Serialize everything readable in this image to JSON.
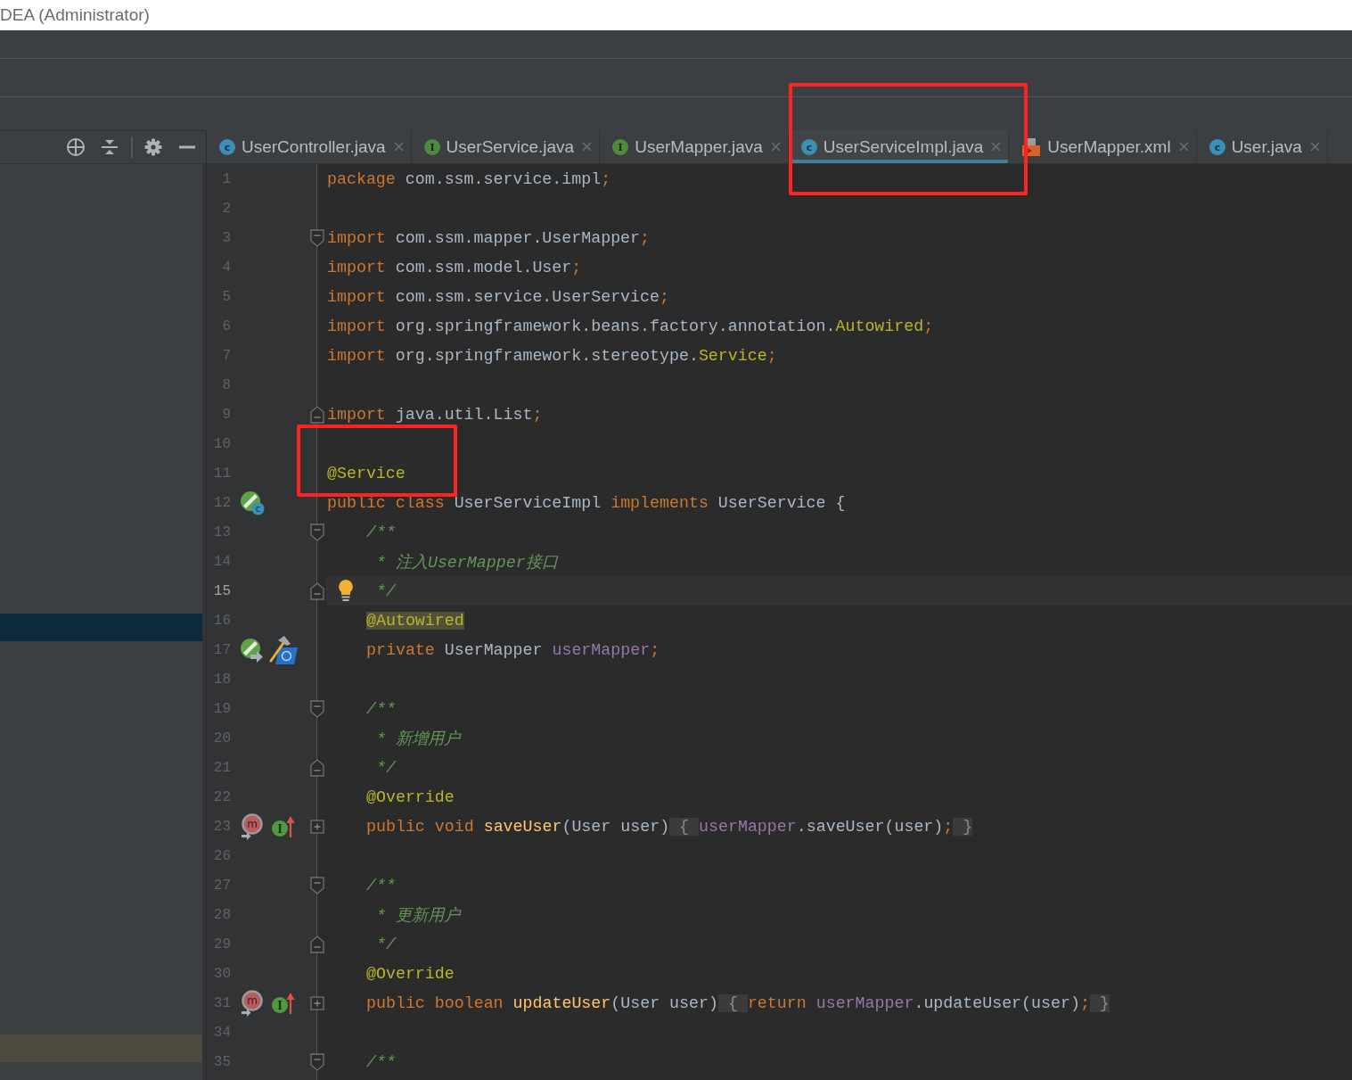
{
  "window": {
    "title": "DEA (Administrator)"
  },
  "project_panel": {
    "rows": [
      {
        "selected": true,
        "highlighted": false
      },
      {
        "selected": false,
        "highlighted": true
      }
    ]
  },
  "tabs": [
    {
      "label": "UserController.java",
      "kind": "class",
      "icon_letter": "c",
      "selected": false,
      "annotated": false
    },
    {
      "label": "UserService.java",
      "kind": "interface",
      "icon_letter": "I",
      "selected": false,
      "annotated": false
    },
    {
      "label": "UserMapper.java",
      "kind": "interface",
      "icon_letter": "I",
      "selected": false,
      "annotated": false
    },
    {
      "label": "UserServiceImpl.java",
      "kind": "class",
      "icon_letter": "c",
      "selected": true,
      "annotated": true
    },
    {
      "label": "UserMapper.xml",
      "kind": "xml",
      "selected": false,
      "annotated": false
    },
    {
      "label": "User.java",
      "kind": "class",
      "icon_letter": "c",
      "selected": false,
      "annotated": false
    }
  ],
  "editor": {
    "lines": [
      {
        "number": "1",
        "kind": "text",
        "tokens": [
          {
            "kind": "keyword",
            "text": "package"
          },
          {
            "kind": "plain",
            "text": " com.ssm.service.impl"
          },
          {
            "kind": "punct",
            "text": ";"
          }
        ],
        "current": false,
        "annotated": false
      },
      {
        "number": "2",
        "kind": "text",
        "current": false,
        "annotated": false
      },
      {
        "number": "3",
        "kind": "fold-start",
        "tokens": [
          {
            "kind": "keyword",
            "text": "import"
          },
          {
            "kind": "plain",
            "text": " com.ssm.mapper.UserMapper"
          },
          {
            "kind": "punct",
            "text": ";"
          }
        ],
        "current": false,
        "annotated": false
      },
      {
        "number": "4",
        "kind": "text",
        "tokens": [
          {
            "kind": "keyword",
            "text": "import"
          },
          {
            "kind": "plain",
            "text": " com.ssm.model.User"
          },
          {
            "kind": "punct",
            "text": ";"
          }
        ],
        "current": false,
        "annotated": false
      },
      {
        "number": "5",
        "kind": "text",
        "tokens": [
          {
            "kind": "keyword",
            "text": "import"
          },
          {
            "kind": "plain",
            "text": " com.ssm.service.UserService"
          },
          {
            "kind": "punct",
            "text": ";"
          }
        ],
        "current": false,
        "annotated": false
      },
      {
        "number": "6",
        "kind": "text",
        "tokens": [
          {
            "kind": "keyword",
            "text": "import"
          },
          {
            "kind": "plain",
            "text": " org.springframework.beans.factory.annotation."
          },
          {
            "kind": "annotation",
            "text": "Autowired"
          },
          {
            "kind": "punct",
            "text": ";"
          }
        ],
        "current": false,
        "annotated": false
      },
      {
        "number": "7",
        "kind": "text",
        "tokens": [
          {
            "kind": "keyword",
            "text": "import"
          },
          {
            "kind": "plain",
            "text": " org.springframework.stereotype."
          },
          {
            "kind": "annotation",
            "text": "Service"
          },
          {
            "kind": "punct",
            "text": ";"
          }
        ],
        "current": false,
        "annotated": false
      },
      {
        "number": "8",
        "kind": "text",
        "current": false,
        "annotated": false
      },
      {
        "number": "9",
        "kind": "fold-end",
        "tokens": [
          {
            "kind": "keyword",
            "text": "import"
          },
          {
            "kind": "plain",
            "text": " java.util.List"
          },
          {
            "kind": "punct",
            "text": ";"
          }
        ],
        "current": false,
        "annotated": false
      },
      {
        "number": "10",
        "kind": "text",
        "current": false,
        "annotated": false
      },
      {
        "number": "11",
        "kind": "text",
        "tokens": [
          {
            "kind": "annotation",
            "text": "@Service"
          }
        ],
        "current": false,
        "annotated": true
      },
      {
        "number": "12",
        "kind": "text",
        "markers": [
          {
            "kind": "bean",
            "letter": "c"
          }
        ],
        "tokens": [
          {
            "kind": "keyword",
            "text": "public class "
          },
          {
            "kind": "plain",
            "text": "UserServiceImpl "
          },
          {
            "kind": "keyword",
            "text": "implements "
          },
          {
            "kind": "plain",
            "text": "UserService {"
          }
        ],
        "current": false,
        "annotated": false,
        "children": [
          {
            "number": "13",
            "kind": "fold-start",
            "tokens": [
              {
                "kind": "comment",
                "text": "/**"
              }
            ],
            "current": false,
            "annotated": false
          },
          {
            "number": "14",
            "kind": "text",
            "tokens": [
              {
                "kind": "comment",
                "text": " * 注入UserMapper接口"
              }
            ],
            "current": false,
            "annotated": false
          },
          {
            "number": "15",
            "kind": "fold-end",
            "markers": [
              {
                "kind": "bulb"
              }
            ],
            "tokens": [
              {
                "kind": "comment",
                "text": " */"
              }
            ],
            "current": true,
            "annotated": false
          },
          {
            "number": "16",
            "kind": "text",
            "tokens": [
              {
                "kind": "match",
                "text": "@Autowired"
              }
            ],
            "current": false,
            "annotated": false
          },
          {
            "number": "17",
            "kind": "text",
            "markers": [
              {
                "kind": "bean-ref"
              },
              {
                "kind": "hammer"
              }
            ],
            "tokens": [
              {
                "kind": "keyword",
                "text": "private "
              },
              {
                "kind": "plain",
                "text": "UserMapper "
              },
              {
                "kind": "field",
                "text": "userMapper"
              },
              {
                "kind": "punct",
                "text": ";"
              }
            ],
            "current": false,
            "annotated": false
          },
          {
            "number": "18",
            "kind": "text",
            "current": false,
            "annotated": false
          },
          {
            "number": "19",
            "kind": "fold-start",
            "tokens": [
              {
                "kind": "comment",
                "text": "/**"
              }
            ],
            "current": false,
            "annotated": false
          },
          {
            "number": "20",
            "kind": "text",
            "tokens": [
              {
                "kind": "comment",
                "text": " * 新增用户"
              }
            ],
            "current": false,
            "annotated": false
          },
          {
            "number": "21",
            "kind": "fold-end",
            "tokens": [
              {
                "kind": "comment",
                "text": " */"
              }
            ],
            "current": false,
            "annotated": false
          },
          {
            "number": "22",
            "kind": "text",
            "tokens": [
              {
                "kind": "annotation",
                "text": "@Override"
              }
            ],
            "current": false,
            "annotated": false
          },
          {
            "number": "23",
            "kind": "fold-collapsed",
            "markers": [
              {
                "kind": "override",
                "letter": "m"
              },
              {
                "kind": "implemented",
                "letter": "I"
              }
            ],
            "tokens": [
              {
                "kind": "keyword",
                "text": "public void "
              },
              {
                "kind": "method",
                "text": "saveUser"
              },
              {
                "kind": "plain",
                "text": "(User user)"
              },
              {
                "kind": "fold",
                "text": " { "
              },
              {
                "kind": "field",
                "text": "userMapper"
              },
              {
                "kind": "plain",
                "text": ".saveUser(user)"
              },
              {
                "kind": "punct",
                "text": ";"
              },
              {
                "kind": "fold",
                "text": " }"
              }
            ],
            "current": false,
            "annotated": false
          },
          {
            "number": "26",
            "kind": "text",
            "current": false,
            "annotated": false
          },
          {
            "number": "27",
            "kind": "fold-start",
            "tokens": [
              {
                "kind": "comment",
                "text": "/**"
              }
            ],
            "current": false,
            "annotated": false
          },
          {
            "number": "28",
            "kind": "text",
            "tokens": [
              {
                "kind": "comment",
                "text": " * 更新用户"
              }
            ],
            "current": false,
            "annotated": false
          },
          {
            "number": "29",
            "kind": "fold-end",
            "tokens": [
              {
                "kind": "comment",
                "text": " */"
              }
            ],
            "current": false,
            "annotated": false
          },
          {
            "number": "30",
            "kind": "text",
            "tokens": [
              {
                "kind": "annotation",
                "text": "@Override"
              }
            ],
            "current": false,
            "annotated": false
          },
          {
            "number": "31",
            "kind": "fold-collapsed",
            "markers": [
              {
                "kind": "override",
                "letter": "m"
              },
              {
                "kind": "implemented",
                "letter": "I"
              }
            ],
            "tokens": [
              {
                "kind": "keyword",
                "text": "public boolean "
              },
              {
                "kind": "method",
                "text": "updateUser"
              },
              {
                "kind": "plain",
                "text": "(User user)"
              },
              {
                "kind": "fold",
                "text": " { "
              },
              {
                "kind": "keyword",
                "text": "return "
              },
              {
                "kind": "field",
                "text": "userMapper"
              },
              {
                "kind": "plain",
                "text": ".updateUser(user)"
              },
              {
                "kind": "punct",
                "text": ";"
              },
              {
                "kind": "fold",
                "text": " }"
              }
            ],
            "current": false,
            "annotated": false
          },
          {
            "number": "34",
            "kind": "text",
            "current": false,
            "annotated": false
          },
          {
            "number": "35",
            "kind": "fold-start",
            "tokens": [
              {
                "kind": "comment",
                "text": "/**"
              }
            ],
            "current": false,
            "annotated": false
          }
        ]
      }
    ]
  }
}
